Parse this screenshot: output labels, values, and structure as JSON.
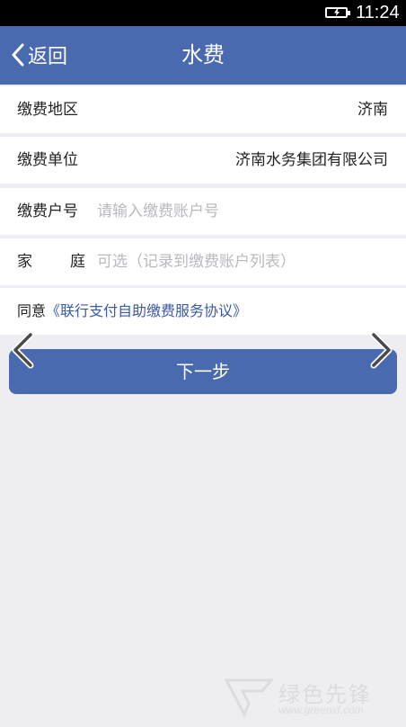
{
  "status_bar": {
    "time": "11:24",
    "battery_icon": "battery-charging-icon"
  },
  "header": {
    "back_label": "返回",
    "title": "水费",
    "back_icon": "chevron-left-icon",
    "background_color": "#4a6aaf"
  },
  "form": {
    "region": {
      "label": "缴费地区",
      "value": "济南"
    },
    "company": {
      "label": "缴费单位",
      "value": "济南水务集团有限公司"
    },
    "account": {
      "label": "缴费户号",
      "placeholder": "请输入缴费账户号"
    },
    "family": {
      "label_part1": "家",
      "label_part2": "庭",
      "placeholder": "可选（记录到缴费账户列表）"
    }
  },
  "agreement": {
    "prefix": "同意",
    "link_text": "《联行支付自助缴费服务协议》"
  },
  "next_button_label": "下一步",
  "overlay_arrows": {
    "left_icon": "arrow-left-icon",
    "right_icon": "arrow-right-icon"
  },
  "watermark": {
    "text": "绿色先锋",
    "url": "www.greenxf.com"
  }
}
